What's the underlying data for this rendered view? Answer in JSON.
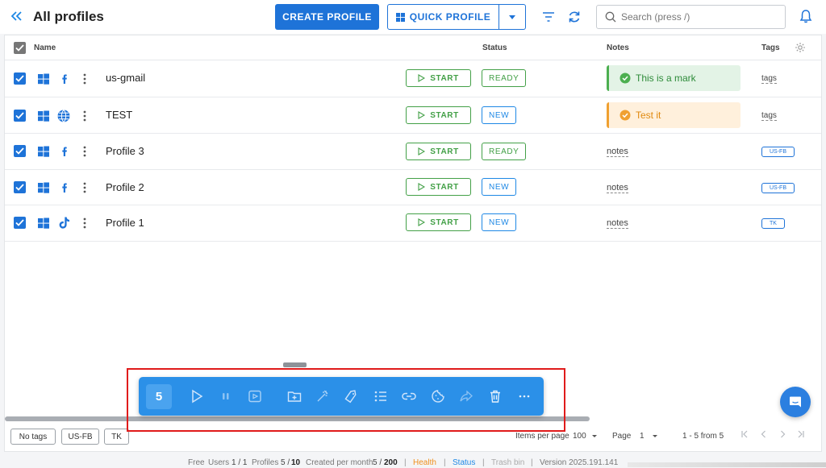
{
  "header": {
    "title": "All profiles",
    "create_label": "CREATE PROFILE",
    "quick_label": "QUICK PROFILE",
    "search_placeholder": "Search (press /)"
  },
  "table": {
    "columns": {
      "name": "Name",
      "status": "Status",
      "notes": "Notes",
      "tags": "Tags"
    },
    "start_label": "START",
    "rows": [
      {
        "name": "us-gmail",
        "os": "windows",
        "site": "facebook-icon",
        "status": "READY",
        "note": "This is a mark",
        "note_style": "green",
        "tag": "tags",
        "tag_style": "plain"
      },
      {
        "name": "TEST",
        "os": "windows",
        "site": "globe-icon",
        "status": "NEW",
        "note": "Test it",
        "note_style": "orange",
        "tag": "tags",
        "tag_style": "plain"
      },
      {
        "name": "Profile 3",
        "os": "windows",
        "site": "facebook-icon",
        "status": "READY",
        "note": "notes",
        "note_style": "plain",
        "tag": "US-FB",
        "tag_style": "chip"
      },
      {
        "name": "Profile 2",
        "os": "windows",
        "site": "facebook-icon",
        "status": "NEW",
        "note": "notes",
        "note_style": "plain",
        "tag": "US-FB",
        "tag_style": "chip"
      },
      {
        "name": "Profile 1",
        "os": "windows",
        "site": "tiktok-icon",
        "status": "NEW",
        "note": "notes",
        "note_style": "plain",
        "tag": "TK",
        "tag_style": "chip"
      }
    ]
  },
  "action_bar": {
    "selected_count": "5",
    "icons": [
      "play-icon",
      "pause-icon",
      "video-icon",
      "folder-add-icon",
      "magic-icon",
      "tag-icon",
      "list-icon",
      "link-icon",
      "cookie-icon",
      "share-icon",
      "trash-icon",
      "more-icon"
    ]
  },
  "tag_filters": [
    "No tags",
    "US-FB",
    "TK"
  ],
  "pagination": {
    "items_per_page_label": "Items per page",
    "items_per_page": "100",
    "page_label": "Page",
    "page": "1",
    "range": "1 - 5 from 5"
  },
  "statusbar": {
    "plan": "Free",
    "users_label": "Users",
    "users_value": "1 / 1",
    "profiles_label": "Profiles",
    "profiles_used": "5 /",
    "profiles_total": "10",
    "created_label": "Created per month",
    "created_used": "5 /",
    "created_total": "200",
    "health": "Health",
    "status": "Status",
    "trash": "Trash bin",
    "version": "Version 2025.191.141"
  },
  "colors": {
    "accent": "#1e73d8",
    "ready": "#43a047",
    "new": "#1e88e5",
    "highlight": "#e01b1b"
  }
}
